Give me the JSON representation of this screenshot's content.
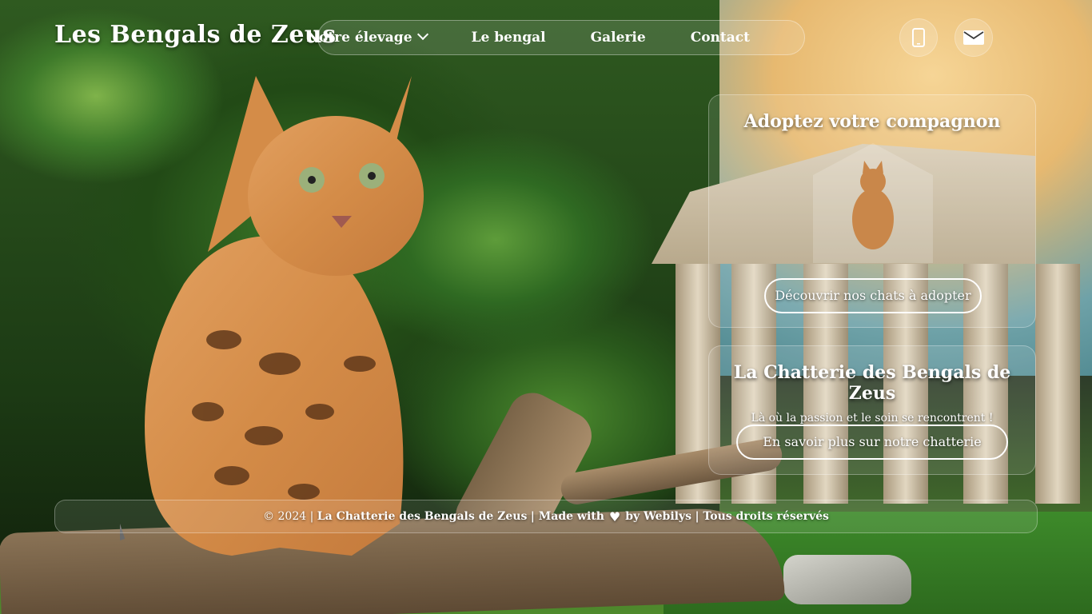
{
  "header": {
    "logo": "Les Bengals de Zeus",
    "nav": [
      {
        "label": "Notre élevage",
        "dropdown": true
      },
      {
        "label": "Le bengal"
      },
      {
        "label": "Galerie"
      },
      {
        "label": "Contact"
      }
    ],
    "icons": [
      "phone-icon",
      "envelope-icon"
    ]
  },
  "adopt_card": {
    "title": "Adoptez votre compagnon",
    "button": "Découvrir nos chats à adopter"
  },
  "about_card": {
    "title": "La Chatterie des Bengals de Zeus",
    "subtitle": "Là où la passion et le soin se rencontrent !",
    "button": "En savoir plus sur notre chatterie"
  },
  "footer": {
    "prefix": "© 2024 |",
    "brand": "La Chatterie des Bengals de Zeus",
    "made_with": "| Made with",
    "by": "by Webilys",
    "rights": "| Tous droits réservés"
  }
}
